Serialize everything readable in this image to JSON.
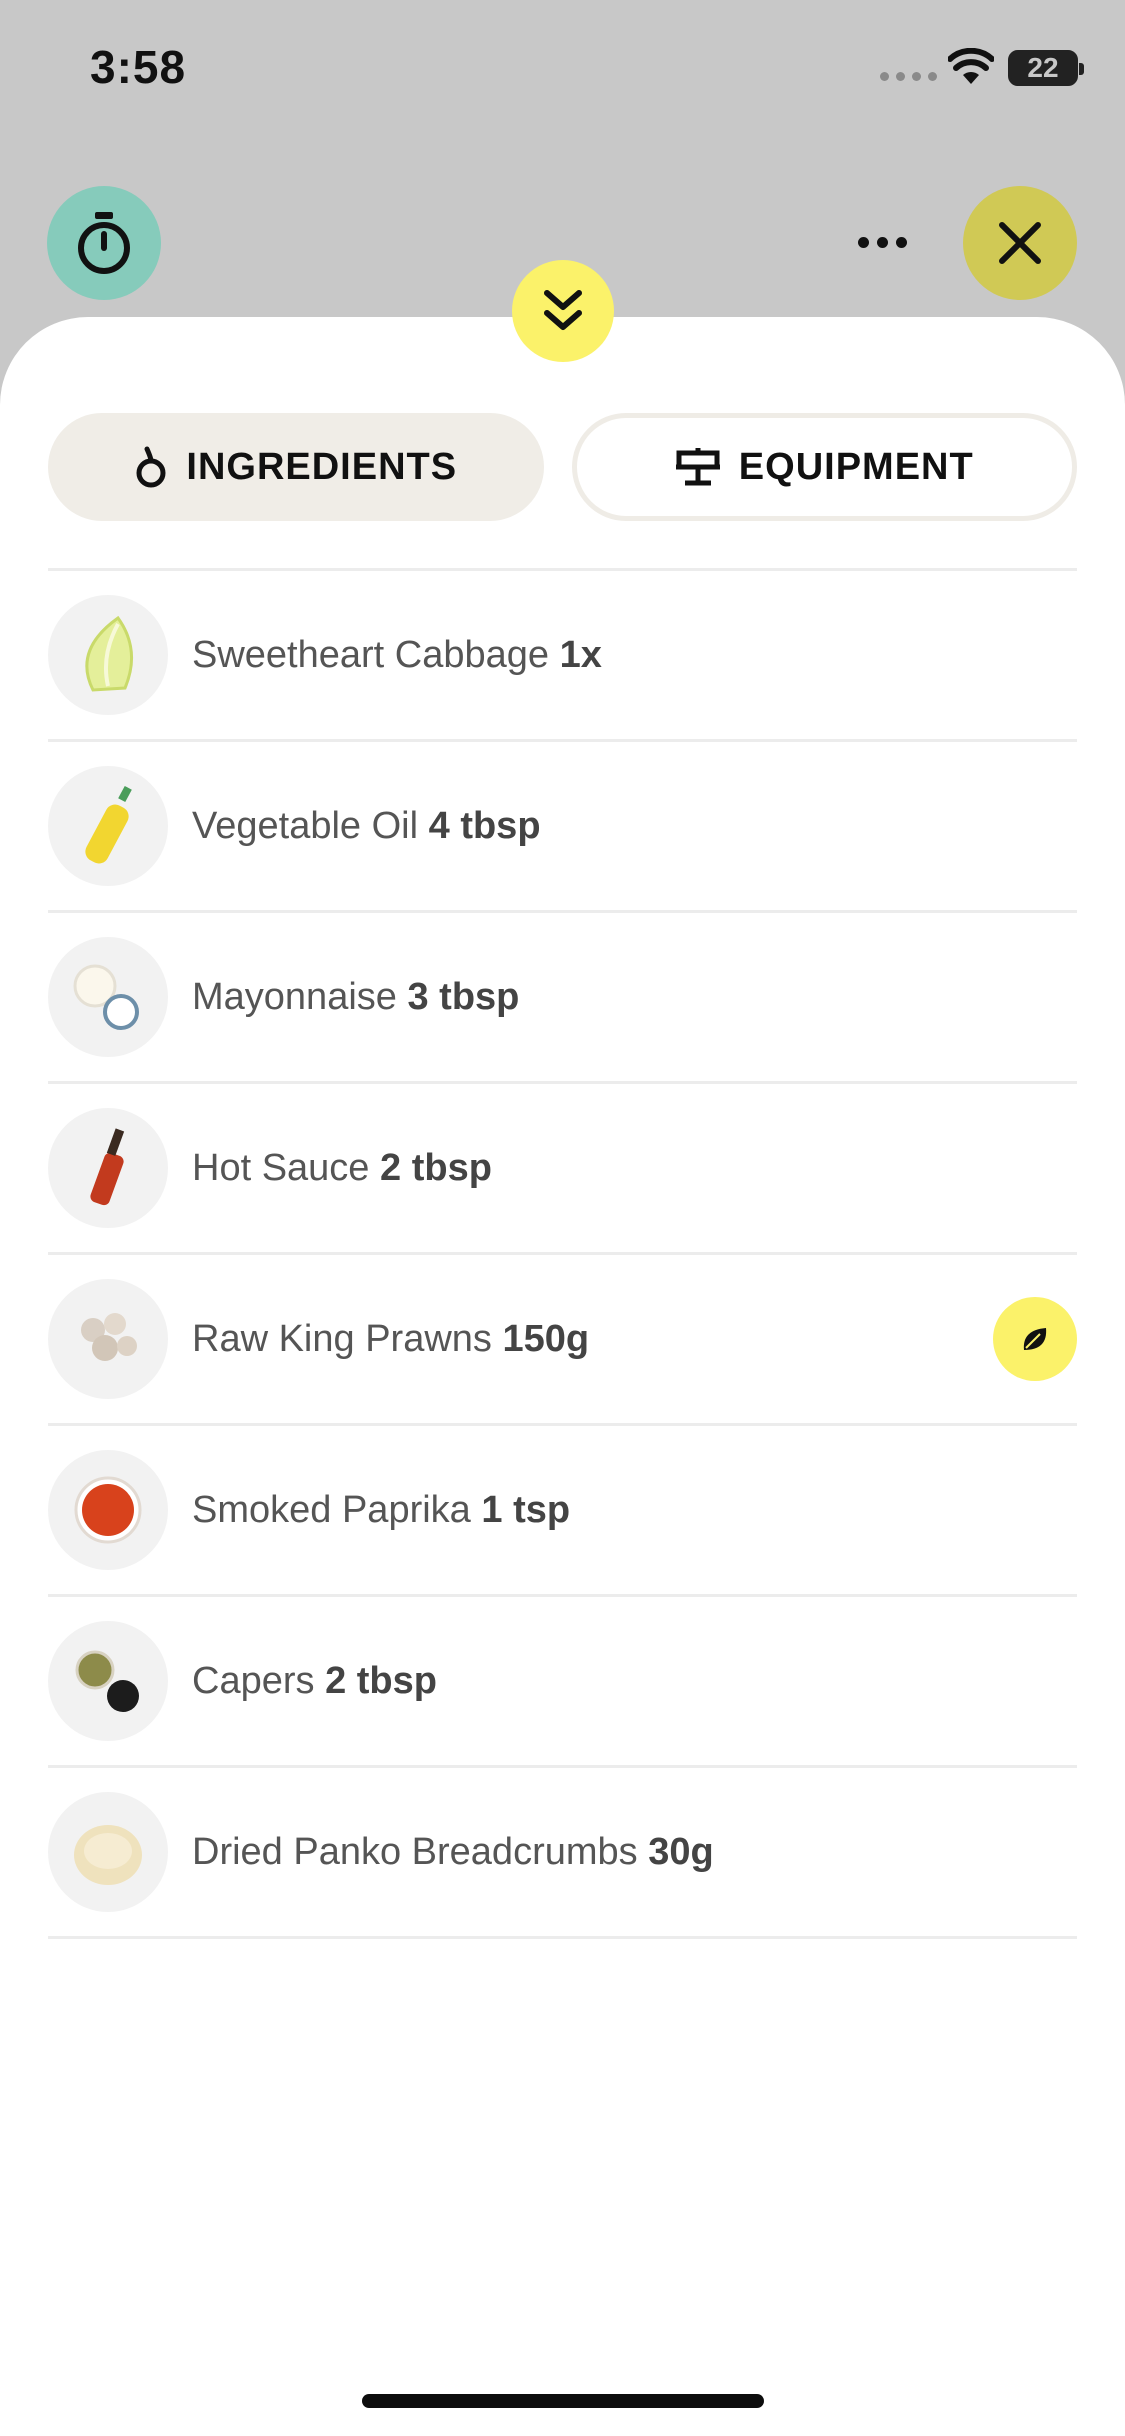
{
  "status_bar": {
    "time": "3:58",
    "battery": "22"
  },
  "header": {
    "timer_icon": "stopwatch-icon",
    "more_icon": "ellipsis-icon",
    "close_icon": "close-icon",
    "collapse_icon": "double-chevron-down-icon",
    "timer_color": "#86cbbb",
    "close_color": "#d0c955",
    "accent_yellow": "#fbf26a"
  },
  "tabs": [
    {
      "label": "INGREDIENTS",
      "icon": "onion-icon",
      "active": true
    },
    {
      "label": "EQUIPMENT",
      "icon": "stove-icon",
      "active": false
    }
  ],
  "ingredients": [
    {
      "name": "Sweetheart Cabbage",
      "qty": "1x"
    },
    {
      "name": "Vegetable Oil",
      "qty": "4 tbsp"
    },
    {
      "name": "Mayonnaise",
      "qty": "3 tbsp"
    },
    {
      "name": "Hot Sauce",
      "qty": "2 tbsp"
    },
    {
      "name": "Raw King Prawns",
      "qty": "150g",
      "badge_icon": "leaf-icon"
    },
    {
      "name": "Smoked Paprika",
      "qty": "1 tsp"
    },
    {
      "name": "Capers",
      "qty": "2 tbsp"
    },
    {
      "name": "Dried Panko Breadcrumbs",
      "qty": "30g"
    }
  ]
}
